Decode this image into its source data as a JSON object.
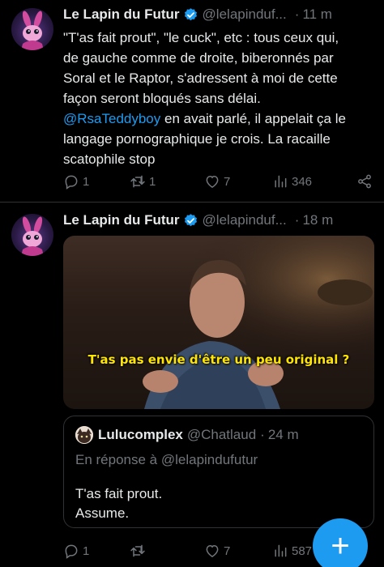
{
  "feed": {
    "tweets": [
      {
        "author_name": "Le Lapin du Futur",
        "author_handle": "@lelapinduf...",
        "time": "11 m",
        "body_lines": [
          "\"T'as fait prout\", \"le cuck\", etc : tous ceux qui,",
          "de gauche comme de droite, biberonnés par",
          "Soral et le Raptor, s'adressent à moi de cette",
          "façon seront bloqués sans délai."
        ],
        "mention": "@RsaTeddyboy",
        "body_after_mention": " en avait parlé, il appelait ça le",
        "body_lines_end": [
          "langage pornographique je crois. La racaille",
          "scatophile stop"
        ],
        "replies": "1",
        "reposts": "1",
        "likes": "7",
        "views": "346"
      },
      {
        "author_name": "Le Lapin du Futur",
        "author_handle": "@lelapinduf...",
        "time": "18 m",
        "video_subtitle": "T'as pas envie d'être un peu original ?",
        "quote": {
          "author_name": "Lulucomplex",
          "author_handle": "@Chatlaud",
          "time": "24 m",
          "reply_to": "En réponse à @lelapindufutur",
          "text_lines": [
            "T'as fait prout.",
            "Assume."
          ]
        },
        "replies": "1",
        "reposts": "",
        "likes": "7",
        "views": "587"
      }
    ]
  },
  "compose_button": "+",
  "colors": {
    "accent": "#1d9bf0",
    "muted": "#71767b",
    "verified": "#1d9bf0",
    "subtitle": "#ffe500"
  },
  "icons": [
    "reply-icon",
    "repost-icon",
    "like-icon",
    "views-icon",
    "share-icon",
    "verified-badge-icon",
    "more-icon"
  ]
}
